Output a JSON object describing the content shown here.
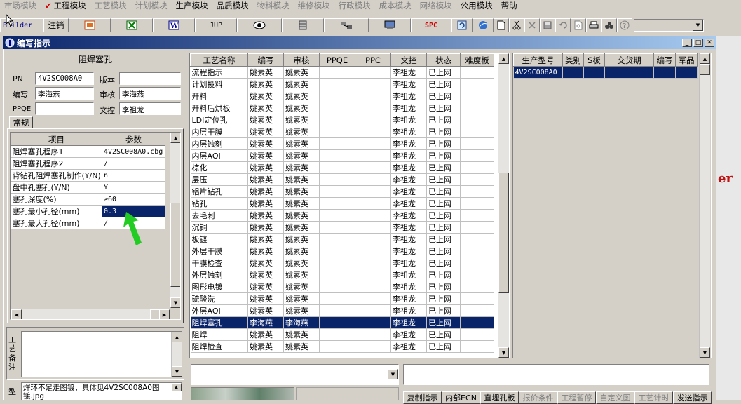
{
  "menu": [
    {
      "label": "市场模块",
      "disabled": true
    },
    {
      "label": "工程模块",
      "disabled": false,
      "checked": true
    },
    {
      "label": "工艺模块",
      "disabled": true
    },
    {
      "label": "计划模块",
      "disabled": true
    },
    {
      "label": "生产模块",
      "disabled": false
    },
    {
      "label": "品质模块",
      "disabled": false
    },
    {
      "label": "物料模块",
      "disabled": true
    },
    {
      "label": "维修模块",
      "disabled": true
    },
    {
      "label": "行政模块",
      "disabled": true
    },
    {
      "label": "成本模块",
      "disabled": true
    },
    {
      "label": "网络模块",
      "disabled": true
    },
    {
      "label": "公用模块",
      "disabled": false
    },
    {
      "label": "帮助",
      "disabled": false
    }
  ],
  "toolbar": {
    "builder_label": "Builder",
    "logout_label": "注销",
    "jup_label": "JUP",
    "spc_label": "SPC"
  },
  "window": {
    "title": "编写指示"
  },
  "left_panel": {
    "title": "阻焊塞孔",
    "pn_label": "PN",
    "pn_value": "4V2SC008A0",
    "version_label": "版本",
    "version_value": "",
    "author_label": "编写",
    "author_value": "李海燕",
    "reviewer_label": "审核",
    "reviewer_value": "李海燕",
    "ppqe_label": "PPQE",
    "ppqe_value": "",
    "doc_label": "文控",
    "doc_value": "李祖龙",
    "tab_label": "常规",
    "col_item": "项目",
    "col_param": "参数",
    "params": [
      {
        "item": "阻焊塞孔程序1",
        "value": "4V2SC008A0.cbg"
      },
      {
        "item": "阻焊塞孔程序2",
        "value": "/"
      },
      {
        "item": "背钻孔阻焊塞孔制作(Y/N)",
        "value": "n"
      },
      {
        "item": "盘中孔塞孔(Y/N)",
        "value": "Y"
      },
      {
        "item": "塞孔深度(%)",
        "value": "≥60"
      },
      {
        "item": "塞孔最小孔径(mm)",
        "value": "0.3",
        "selected": true
      },
      {
        "item": "塞孔最大孔径(mm)",
        "value": "/"
      }
    ],
    "remark_label": "工艺备注",
    "model_label": "型",
    "remark_text": "焊环不足走图镀，具体见4V2SC008A0图镀.jpg"
  },
  "process_table": {
    "headers": [
      "工艺名称",
      "编写",
      "审核",
      "PPQE",
      "PPC",
      "文控",
      "状态",
      "难度板"
    ],
    "rows": [
      [
        "流程指示",
        "姚素英",
        "姚素英",
        "",
        "",
        "李祖龙",
        "已上网",
        ""
      ],
      [
        "计划投料",
        "姚素英",
        "姚素英",
        "",
        "",
        "李祖龙",
        "已上网",
        ""
      ],
      [
        "开料",
        "姚素英",
        "姚素英",
        "",
        "",
        "李祖龙",
        "已上网",
        ""
      ],
      [
        "开料后烘板",
        "姚素英",
        "姚素英",
        "",
        "",
        "李祖龙",
        "已上网",
        ""
      ],
      [
        "LDI定位孔",
        "姚素英",
        "姚素英",
        "",
        "",
        "李祖龙",
        "已上网",
        ""
      ],
      [
        "内层干膜",
        "姚素英",
        "姚素英",
        "",
        "",
        "李祖龙",
        "已上网",
        ""
      ],
      [
        "内层蚀刻",
        "姚素英",
        "姚素英",
        "",
        "",
        "李祖龙",
        "已上网",
        ""
      ],
      [
        "内层AOI",
        "姚素英",
        "姚素英",
        "",
        "",
        "李祖龙",
        "已上网",
        ""
      ],
      [
        "棕化",
        "姚素英",
        "姚素英",
        "",
        "",
        "李祖龙",
        "已上网",
        ""
      ],
      [
        "层压",
        "姚素英",
        "姚素英",
        "",
        "",
        "李祖龙",
        "已上网",
        ""
      ],
      [
        "铝片钻孔",
        "姚素英",
        "姚素英",
        "",
        "",
        "李祖龙",
        "已上网",
        ""
      ],
      [
        "钻孔",
        "姚素英",
        "姚素英",
        "",
        "",
        "李祖龙",
        "已上网",
        ""
      ],
      [
        "去毛刺",
        "姚素英",
        "姚素英",
        "",
        "",
        "李祖龙",
        "已上网",
        ""
      ],
      [
        "沉铜",
        "姚素英",
        "姚素英",
        "",
        "",
        "李祖龙",
        "已上网",
        ""
      ],
      [
        "板镀",
        "姚素英",
        "姚素英",
        "",
        "",
        "李祖龙",
        "已上网",
        ""
      ],
      [
        "外层干膜",
        "姚素英",
        "姚素英",
        "",
        "",
        "李祖龙",
        "已上网",
        ""
      ],
      [
        "干膜检查",
        "姚素英",
        "姚素英",
        "",
        "",
        "李祖龙",
        "已上网",
        ""
      ],
      [
        "外层蚀刻",
        "姚素英",
        "姚素英",
        "",
        "",
        "李祖龙",
        "已上网",
        ""
      ],
      [
        "图形电镀",
        "姚素英",
        "姚素英",
        "",
        "",
        "李祖龙",
        "已上网",
        ""
      ],
      [
        "硫酸洗",
        "姚素英",
        "姚素英",
        "",
        "",
        "李祖龙",
        "已上网",
        ""
      ],
      [
        "外层AOI",
        "姚素英",
        "姚素英",
        "",
        "",
        "李祖龙",
        "已上网",
        ""
      ],
      [
        "阻焊塞孔",
        "李海燕",
        "李海燕",
        "",
        "",
        "李祖龙",
        "已上网",
        ""
      ],
      [
        "阻焊",
        "姚素英",
        "姚素英",
        "",
        "",
        "李祖龙",
        "已上网",
        ""
      ],
      [
        "阻焊检查",
        "姚素英",
        "姚素英",
        "",
        "",
        "李祖龙",
        "已上网",
        ""
      ]
    ],
    "selected_row": 21
  },
  "right_table": {
    "headers": [
      "生产型号",
      "类别",
      "S板",
      "交货期",
      "编写",
      "军品"
    ],
    "rows": [
      [
        "4V2SC008A0",
        "",
        "",
        "",
        "",
        ""
      ]
    ]
  },
  "bottom_buttons": [
    {
      "label": "复制指示",
      "disabled": false
    },
    {
      "label": "内部ECN",
      "disabled": false
    },
    {
      "label": "直埋孔板",
      "disabled": false
    },
    {
      "label": "报价条件",
      "disabled": true
    },
    {
      "label": "工程暂停",
      "disabled": true
    },
    {
      "label": "自定义图",
      "disabled": true
    },
    {
      "label": "工艺计时",
      "disabled": true
    },
    {
      "label": "发送指示",
      "disabled": false
    }
  ],
  "background_text": "er",
  "colors": {
    "titlebar": "#0a246a",
    "selection": "#0a246a",
    "cursor_arrow": "#22cc22",
    "menu_check": "#d00000"
  }
}
